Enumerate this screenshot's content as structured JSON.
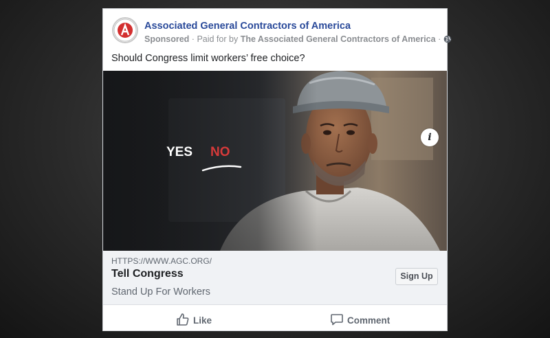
{
  "post": {
    "page_name": "Associated General Contractors of America",
    "sponsored": "Sponsored",
    "paid_prefix": "Paid for by",
    "paid_by": "The Associated General Contractors of America",
    "separator": "·",
    "text": "Should Congress limit workers’ free choice?"
  },
  "image": {
    "yes": "YES",
    "no": "NO",
    "info": "i"
  },
  "link": {
    "url": "HTTPS://WWW.AGC.ORG/",
    "title": "Tell Congress",
    "description": "Stand Up For Workers",
    "cta": "Sign Up"
  },
  "actions": {
    "like": "Like",
    "comment": "Comment"
  },
  "colors": {
    "page_name": "#2a4a9a",
    "logo_red": "#d32f2f",
    "no_red": "#d63a3a"
  }
}
